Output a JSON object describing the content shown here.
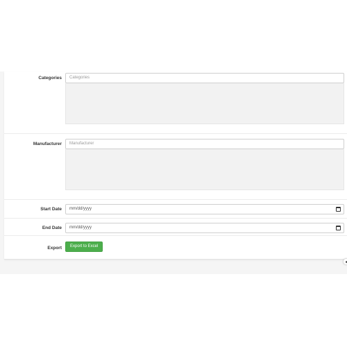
{
  "form": {
    "categories": {
      "label": "Categories",
      "placeholder": "Categories"
    },
    "manufacturer": {
      "label": "Manufacturer",
      "placeholder": "Manufacturer"
    },
    "start_date": {
      "label": "Start Date",
      "placeholder": "mm/dd/yyyy"
    },
    "end_date": {
      "label": "End Date",
      "placeholder": "mm/dd/yyyy"
    },
    "export": {
      "label": "Export",
      "button_label": "Export to Excel"
    }
  },
  "colors": {
    "button": "#4cae4c",
    "listbox": "#f2f2f2",
    "page_background": "#f5f5f5"
  },
  "icons": [
    "calendar-icon",
    "help-icon"
  ]
}
